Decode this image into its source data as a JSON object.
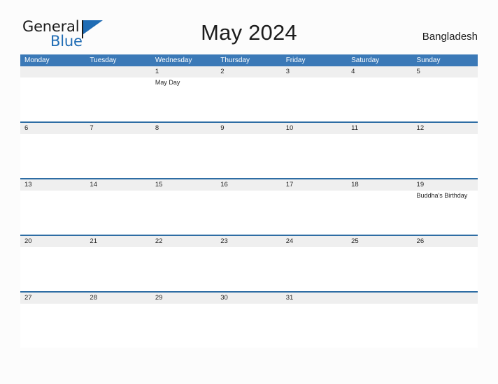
{
  "brand": {
    "name_part1": "General",
    "name_part2": "Blue",
    "flag_icon": "flag-triangle-icon",
    "accent_color": "#1f6cb4"
  },
  "header": {
    "title": "May 2024",
    "country": "Bangladesh"
  },
  "colors": {
    "header_blue": "#3b79b7",
    "rule_blue": "#2e6da4",
    "date_band_gray": "#efefef",
    "page_background": "#fcfcfc",
    "text": "#1c1c1c"
  },
  "calendar": {
    "month": "May",
    "year": "2024",
    "week_start": "Monday",
    "day_names": [
      "Monday",
      "Tuesday",
      "Wednesday",
      "Thursday",
      "Friday",
      "Saturday",
      "Sunday"
    ],
    "weeks": [
      {
        "days": [
          {
            "num": "",
            "events": []
          },
          {
            "num": "",
            "events": []
          },
          {
            "num": "1",
            "events": [
              "May Day"
            ]
          },
          {
            "num": "2",
            "events": []
          },
          {
            "num": "3",
            "events": []
          },
          {
            "num": "4",
            "events": []
          },
          {
            "num": "5",
            "events": []
          }
        ]
      },
      {
        "days": [
          {
            "num": "6",
            "events": []
          },
          {
            "num": "7",
            "events": []
          },
          {
            "num": "8",
            "events": []
          },
          {
            "num": "9",
            "events": []
          },
          {
            "num": "10",
            "events": []
          },
          {
            "num": "11",
            "events": []
          },
          {
            "num": "12",
            "events": []
          }
        ]
      },
      {
        "days": [
          {
            "num": "13",
            "events": []
          },
          {
            "num": "14",
            "events": []
          },
          {
            "num": "15",
            "events": []
          },
          {
            "num": "16",
            "events": []
          },
          {
            "num": "17",
            "events": []
          },
          {
            "num": "18",
            "events": []
          },
          {
            "num": "19",
            "events": [
              "Buddha's Birthday"
            ]
          }
        ]
      },
      {
        "days": [
          {
            "num": "20",
            "events": []
          },
          {
            "num": "21",
            "events": []
          },
          {
            "num": "22",
            "events": []
          },
          {
            "num": "23",
            "events": []
          },
          {
            "num": "24",
            "events": []
          },
          {
            "num": "25",
            "events": []
          },
          {
            "num": "26",
            "events": []
          }
        ]
      },
      {
        "days": [
          {
            "num": "27",
            "events": []
          },
          {
            "num": "28",
            "events": []
          },
          {
            "num": "29",
            "events": []
          },
          {
            "num": "30",
            "events": []
          },
          {
            "num": "31",
            "events": []
          },
          {
            "num": "",
            "events": []
          },
          {
            "num": "",
            "events": []
          }
        ]
      }
    ]
  }
}
